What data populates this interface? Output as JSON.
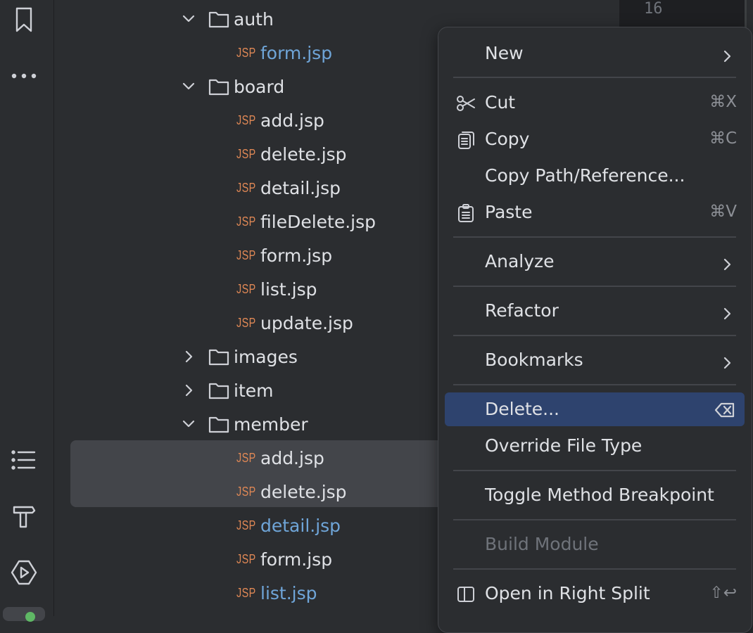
{
  "tree": {
    "rows": [
      {
        "kind": "folder",
        "label": "auth",
        "state": "expanded",
        "level": 1
      },
      {
        "kind": "file",
        "label": "form.jsp",
        "badge": "JSP",
        "modified": true
      },
      {
        "kind": "folder",
        "label": "board",
        "state": "expanded",
        "level": 1
      },
      {
        "kind": "file",
        "label": "add.jsp",
        "badge": "JSP",
        "modified": false
      },
      {
        "kind": "file",
        "label": "delete.jsp",
        "badge": "JSP",
        "modified": false
      },
      {
        "kind": "file",
        "label": "detail.jsp",
        "badge": "JSP",
        "modified": false
      },
      {
        "kind": "file",
        "label": "fileDelete.jsp",
        "badge": "JSP",
        "modified": false
      },
      {
        "kind": "file",
        "label": "form.jsp",
        "badge": "JSP",
        "modified": false
      },
      {
        "kind": "file",
        "label": "list.jsp",
        "badge": "JSP",
        "modified": false
      },
      {
        "kind": "file",
        "label": "update.jsp",
        "badge": "JSP",
        "modified": false
      },
      {
        "kind": "folder",
        "label": "images",
        "state": "collapsed",
        "level": 1
      },
      {
        "kind": "folder",
        "label": "item",
        "state": "collapsed",
        "level": 1
      },
      {
        "kind": "folder",
        "label": "member",
        "state": "expanded",
        "level": 1
      },
      {
        "kind": "file",
        "label": "add.jsp",
        "badge": "JSP",
        "modified": false,
        "selected": true
      },
      {
        "kind": "file",
        "label": "delete.jsp",
        "badge": "JSP",
        "modified": false,
        "selected": true
      },
      {
        "kind": "file",
        "label": "detail.jsp",
        "badge": "JSP",
        "modified": true
      },
      {
        "kind": "file",
        "label": "form.jsp",
        "badge": "JSP",
        "modified": false
      },
      {
        "kind": "file",
        "label": "list.jsp",
        "badge": "JSP",
        "modified": true
      }
    ]
  },
  "editor": {
    "line_number": "16"
  },
  "menu": {
    "new": {
      "label": "New"
    },
    "cut": {
      "label": "Cut",
      "shortcut": "⌘X"
    },
    "copy": {
      "label": "Copy",
      "shortcut": "⌘C"
    },
    "copy_path": {
      "label": "Copy Path/Reference..."
    },
    "paste": {
      "label": "Paste",
      "shortcut": "⌘V"
    },
    "analyze": {
      "label": "Analyze"
    },
    "refactor": {
      "label": "Refactor"
    },
    "bookmarks": {
      "label": "Bookmarks"
    },
    "delete": {
      "label": "Delete...",
      "highlighted": true
    },
    "override_file_type": {
      "label": "Override File Type"
    },
    "toggle_method_breakpoint": {
      "label": "Toggle Method Breakpoint"
    },
    "build_module": {
      "label": "Build Module",
      "disabled": true
    },
    "open_right_split": {
      "label": "Open in Right Split",
      "shortcut": "⇧↩"
    }
  },
  "colors": {
    "background": "#2b2d30",
    "highlight": "#2e436e",
    "selection": "#43454a",
    "jsp_badge": "#e08855",
    "modified_file": "#6fa5d8",
    "text": "#dfe1e5",
    "disabled_text": "#6f737a"
  },
  "icons": {
    "strip": [
      "bookmark-icon",
      "more-icon",
      "structure-icon",
      "build-icon",
      "run-icon"
    ]
  }
}
